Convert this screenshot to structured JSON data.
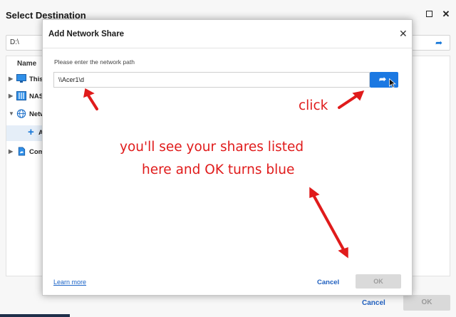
{
  "back_window": {
    "title": "Select Destination",
    "maximize_label": "maximize",
    "close_symbol": "✕",
    "path_value": "D:\\",
    "column_name": "Name",
    "tree": [
      {
        "label": "This",
        "icon": "computer-icon",
        "caret": "▶"
      },
      {
        "label": "NAS",
        "icon": "nas-icon",
        "caret": "▶"
      },
      {
        "label": "Netw",
        "icon": "globe-icon",
        "caret": "▼"
      },
      {
        "label": "A",
        "icon": "plus-icon"
      },
      {
        "label": "Com",
        "icon": "cloud-icon",
        "caret": "▶"
      }
    ],
    "cancel_label": "Cancel",
    "ok_label": "OK"
  },
  "dialog": {
    "title": "Add Network Share",
    "close_symbol": "✕",
    "prompt": "Please enter the network path",
    "network_path_value": "\\\\Acer1\\d",
    "go_symbol": "➦",
    "learn_more_label": "Learn more",
    "cancel_label": "Cancel",
    "ok_label": "OK"
  },
  "annotations": {
    "click": "click",
    "line1": "you'll see your shares listed",
    "line2": "here and OK turns blue"
  },
  "colors": {
    "accent_blue": "#1b78e2",
    "link_blue": "#1f5fbf",
    "annotation_red": "#e01b1b",
    "disabled_button": "#dadada"
  }
}
